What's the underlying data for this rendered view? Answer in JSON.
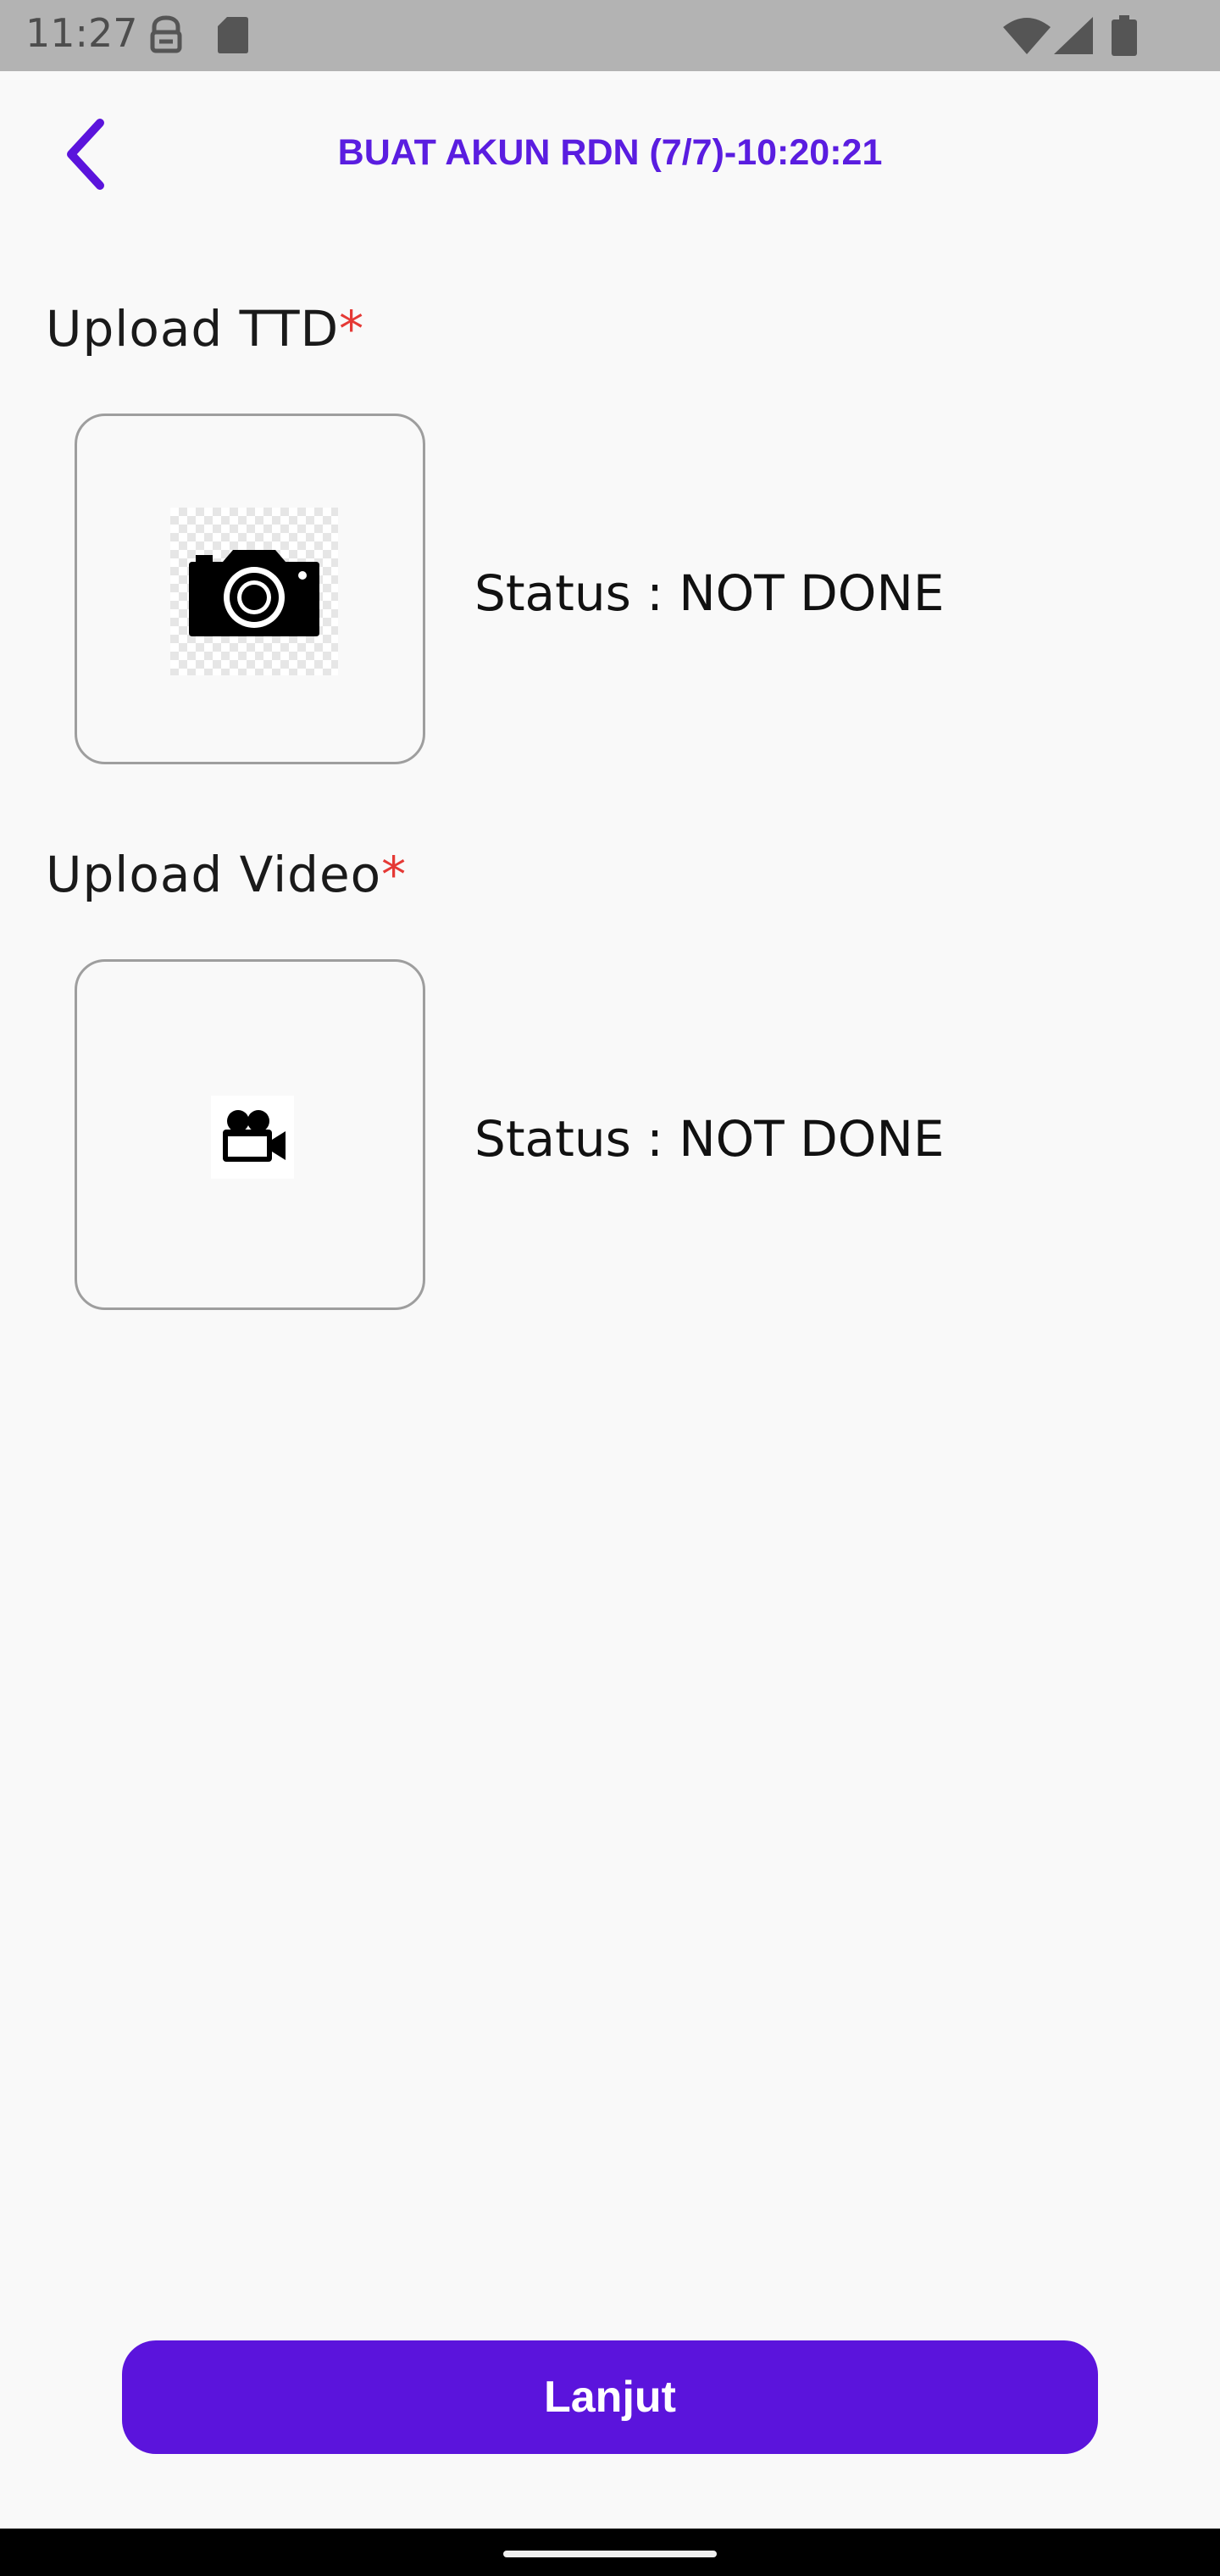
{
  "status_bar": {
    "time": "11:27",
    "icons": [
      "lock-badge-icon",
      "sd-card-icon",
      "wifi-icon",
      "signal-icon",
      "battery-icon"
    ]
  },
  "header": {
    "title": "BUAT AKUN RDN (7/7)-10:20:21",
    "back_icon": "chevron-left-icon",
    "accent_color": "#5b14dc"
  },
  "sections": [
    {
      "label": "Upload TTD",
      "required_mark": "*",
      "icon": "camera-icon",
      "status": "Status : NOT DONE"
    },
    {
      "label": "Upload Video",
      "required_mark": "*",
      "icon": "video-camera-icon",
      "status": "Status : NOT DONE"
    }
  ],
  "footer": {
    "next_button_label": "Lanjut"
  }
}
